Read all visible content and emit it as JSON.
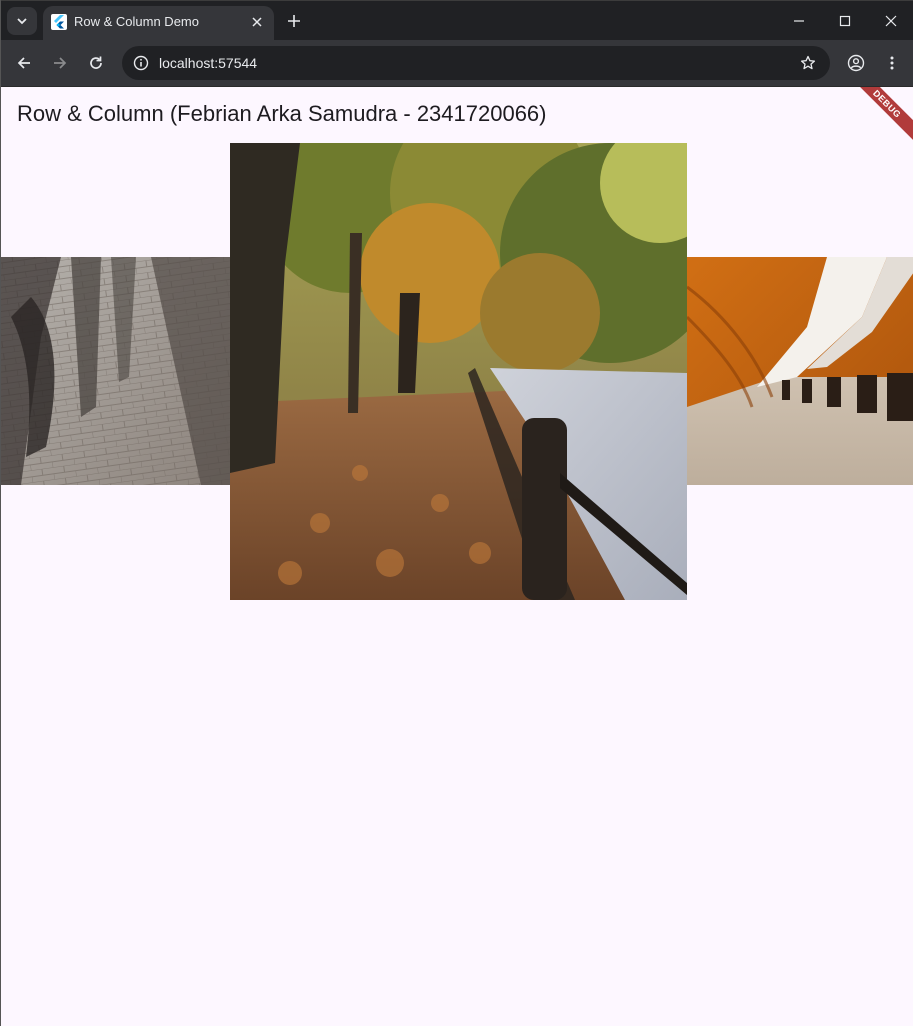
{
  "browser": {
    "tab_title": "Row & Column Demo",
    "url": "localhost:57544",
    "tab_icon": "flutter-icon"
  },
  "app": {
    "title": "Row & Column (Febrian Arka Samudra - 2341720066)",
    "debug_banner": "DEBUG"
  },
  "images": [
    {
      "name": "left-image",
      "subject": "shadows of people walking on brick pavement"
    },
    {
      "name": "center-image",
      "subject": "autumn trees along a riverside path"
    },
    {
      "name": "right-image",
      "subject": "orange curved subway tunnel"
    }
  ],
  "colors": {
    "page_bg": "#fdf7ff",
    "tabstrip_bg": "#202124",
    "toolbar_bg": "#35363a",
    "debug_red": "#b13b3b"
  }
}
